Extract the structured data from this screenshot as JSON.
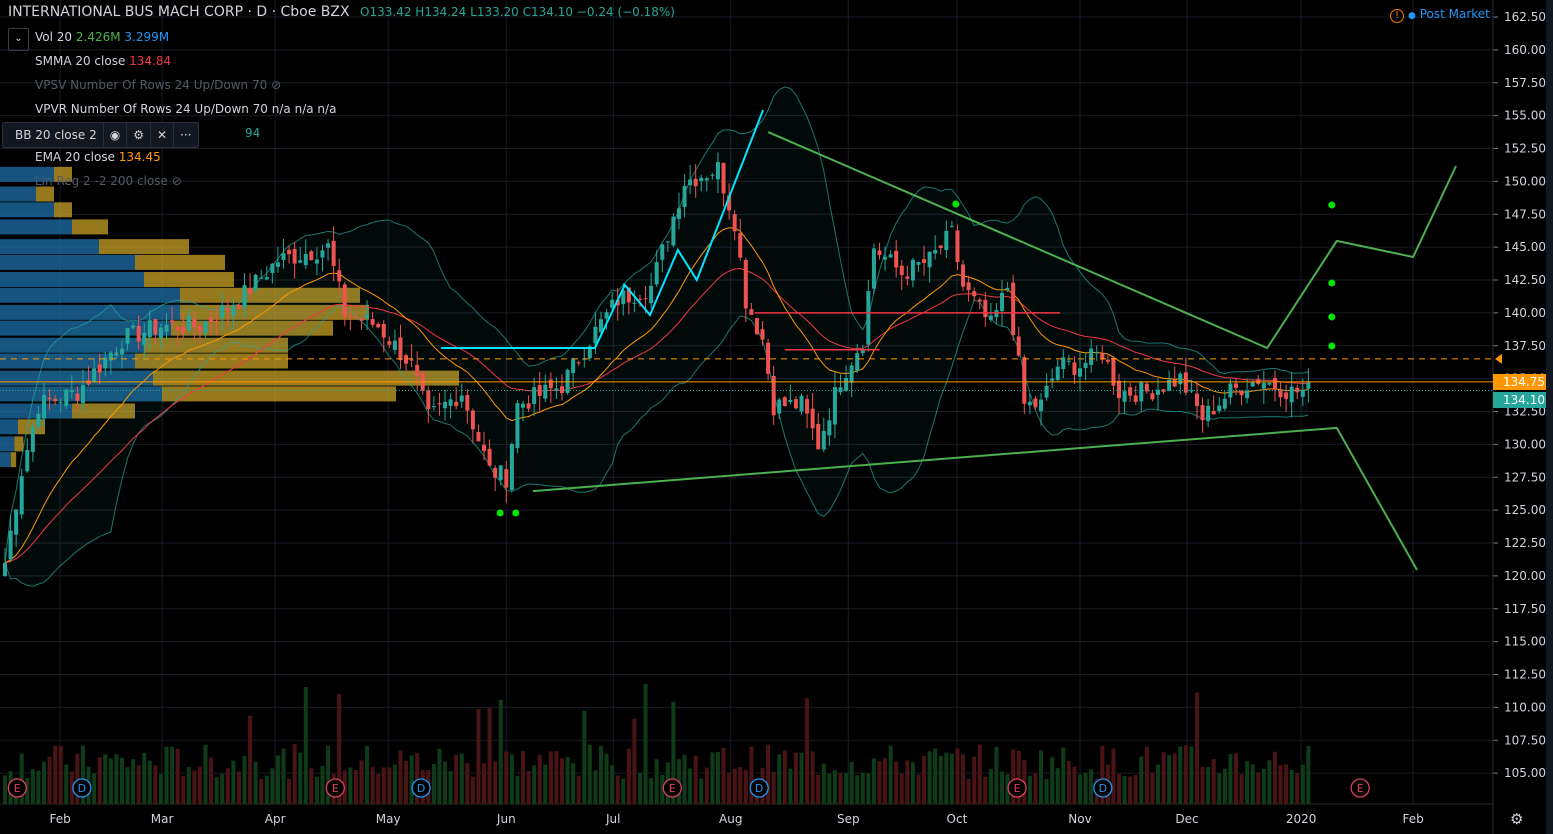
{
  "header": {
    "symbol": "INTERNATIONAL BUS MACH CORP · D · Cboe BZX",
    "open": "O133.42",
    "high": "H134.24",
    "low": "L133.20",
    "close": "C134.10",
    "change": "−0.24 (−0.18%)",
    "post_market": "Post Market"
  },
  "indicators": [
    {
      "name": "Vol 20",
      "v1": "2.426M",
      "v2": "3.299M"
    },
    {
      "name": "SMMA 20 close",
      "v1": "134.84"
    },
    {
      "name": "VPSV Number Of Rows 24 Up/Down 70"
    },
    {
      "name": "VPVR Number Of Rows 24 Up/Down 70",
      "v1": "n/a n/a n/a"
    },
    {
      "name": "BB 20 close 2",
      "v1": "94"
    },
    {
      "name": "EMA 20 close",
      "v1": "134.45"
    },
    {
      "name": "Lin Reg 2 -2 200 close"
    }
  ],
  "colors": {
    "up": "#26a69a",
    "down": "#ef5350",
    "bb": "#26a69a",
    "ema": "#ff9800",
    "smma": "#f23645",
    "trend": "#4caf50",
    "zigzag": "#00e5ff",
    "vp_up": "#1e6fa8",
    "vp_down": "#c9a227"
  },
  "price_tags": {
    "last": "134.10",
    "line": "134.75"
  },
  "chart_data": {
    "type": "candlestick",
    "price_ticks": [
      "162.50",
      "160.00",
      "157.50",
      "155.00",
      "152.50",
      "150.00",
      "147.50",
      "145.00",
      "142.50",
      "140.00",
      "137.50",
      "135.00",
      "132.50",
      "130.00",
      "127.50",
      "125.00",
      "122.50",
      "120.00",
      "117.50",
      "115.00",
      "112.50",
      "110.00",
      "107.50",
      "105.00"
    ],
    "ylim": [
      105,
      162.5
    ],
    "months": [
      {
        "label": "Feb",
        "day": 9.9
      },
      {
        "label": "Mar",
        "day": 28.2
      },
      {
        "label": "Apr",
        "day": 48.5
      },
      {
        "label": "May",
        "day": 68.8
      },
      {
        "label": "Jun",
        "day": 90
      },
      {
        "label": "Jul",
        "day": 109.2
      },
      {
        "label": "Aug",
        "day": 130.3
      },
      {
        "label": "Sep",
        "day": 151.4
      },
      {
        "label": "Oct",
        "day": 170.9
      },
      {
        "label": "Nov",
        "day": 193
      },
      {
        "label": "Dec",
        "day": 212.2
      },
      {
        "label": "2020",
        "day": 232.7
      },
      {
        "label": "Feb",
        "day": 252.8
      }
    ],
    "close_anchors": [
      [
        0,
        121
      ],
      [
        3,
        128
      ],
      [
        6,
        133
      ],
      [
        13,
        134
      ],
      [
        21,
        138
      ],
      [
        28,
        139
      ],
      [
        35,
        139
      ],
      [
        42,
        141
      ],
      [
        49,
        144
      ],
      [
        58,
        145
      ],
      [
        61,
        140
      ],
      [
        67,
        139
      ],
      [
        73,
        136
      ],
      [
        76,
        132
      ],
      [
        82,
        134
      ],
      [
        87,
        128
      ],
      [
        90,
        127.5
      ],
      [
        92,
        133
      ],
      [
        100,
        134.5
      ],
      [
        105,
        138
      ],
      [
        110,
        141
      ],
      [
        116,
        142
      ],
      [
        119,
        146
      ],
      [
        122,
        150
      ],
      [
        128,
        151
      ],
      [
        131,
        147
      ],
      [
        133,
        141
      ],
      [
        136,
        138
      ],
      [
        138,
        133
      ],
      [
        143,
        133
      ],
      [
        146,
        130
      ],
      [
        150,
        135
      ],
      [
        154,
        138
      ],
      [
        156,
        145
      ],
      [
        161,
        143
      ],
      [
        166,
        144
      ],
      [
        170,
        146
      ],
      [
        172,
        142
      ],
      [
        177,
        139
      ],
      [
        180,
        142
      ],
      [
        183,
        133
      ],
      [
        186,
        133
      ],
      [
        189,
        136
      ],
      [
        193,
        136
      ],
      [
        197,
        137
      ],
      [
        200,
        134
      ],
      [
        205,
        134
      ],
      [
        211,
        135
      ],
      [
        215,
        132
      ],
      [
        220,
        134
      ],
      [
        225,
        135
      ],
      [
        231,
        134
      ],
      [
        234,
        134.1
      ]
    ],
    "zigzag": [
      [
        78.3,
        137.33
      ],
      [
        105.9,
        137.33
      ],
      [
        111.3,
        142.12
      ],
      [
        115.8,
        139.84
      ],
      [
        120.8,
        144.78
      ],
      [
        124.2,
        142.5
      ],
      [
        136.1,
        155.43
      ]
    ],
    "trend_upper": [
      [
        137,
        153.75
      ],
      [
        226.6,
        137.33
      ],
      [
        239.1,
        145.47
      ],
      [
        252.8,
        144.25
      ],
      [
        260.5,
        151.17
      ]
    ],
    "trend_lower": [
      [
        94.8,
        126.45
      ],
      [
        239.1,
        131.25
      ],
      [
        253.5,
        120.45
      ]
    ],
    "dots": [
      [
        88.9,
        124.78
      ],
      [
        91.7,
        124.78
      ],
      [
        170.7,
        148.28
      ],
      [
        238.2,
        148.2
      ],
      [
        238.2,
        142.27
      ],
      [
        238.2,
        139.69
      ],
      [
        238.2,
        137.48
      ]
    ],
    "red_levels": [
      [
        134.6,
        189.4,
        140
      ],
      [
        140,
        157,
        137.2
      ]
    ],
    "dashed_level": 136.5,
    "line_level": 134.75,
    "last_price": 134.1,
    "events": [
      {
        "t": "E",
        "day": 2.2
      },
      {
        "t": "D",
        "day": 13.8
      },
      {
        "t": "E",
        "day": 59.3
      },
      {
        "t": "D",
        "day": 74.7
      },
      {
        "t": "E",
        "day": 119.8
      },
      {
        "t": "D",
        "day": 135.4
      },
      {
        "t": "E",
        "day": 181.7
      },
      {
        "t": "D",
        "day": 197.1
      },
      {
        "t": "E",
        "day": 243.3
      }
    ],
    "volume_profile": [
      [
        150.5,
        0.3,
        0.1
      ],
      [
        149,
        0.2,
        0.1
      ],
      [
        147.8,
        0.3,
        0.1
      ],
      [
        146.5,
        0.4,
        0.2
      ],
      [
        145,
        0.55,
        0.5
      ],
      [
        143.8,
        0.75,
        0.5
      ],
      [
        142.5,
        0.8,
        0.5
      ],
      [
        141.3,
        1.0,
        1.0
      ],
      [
        140,
        1.0,
        1.05
      ],
      [
        138.8,
        0.95,
        0.9
      ],
      [
        137.5,
        0.8,
        0.8
      ],
      [
        136.3,
        0.75,
        0.85
      ],
      [
        135,
        0.85,
        1.7
      ],
      [
        133.8,
        0.9,
        1.3
      ],
      [
        132.5,
        0.4,
        0.35
      ],
      [
        131.3,
        0.1,
        0.15
      ],
      [
        130,
        0.08,
        0.05
      ],
      [
        128.8,
        0.06,
        0.03
      ]
    ]
  }
}
